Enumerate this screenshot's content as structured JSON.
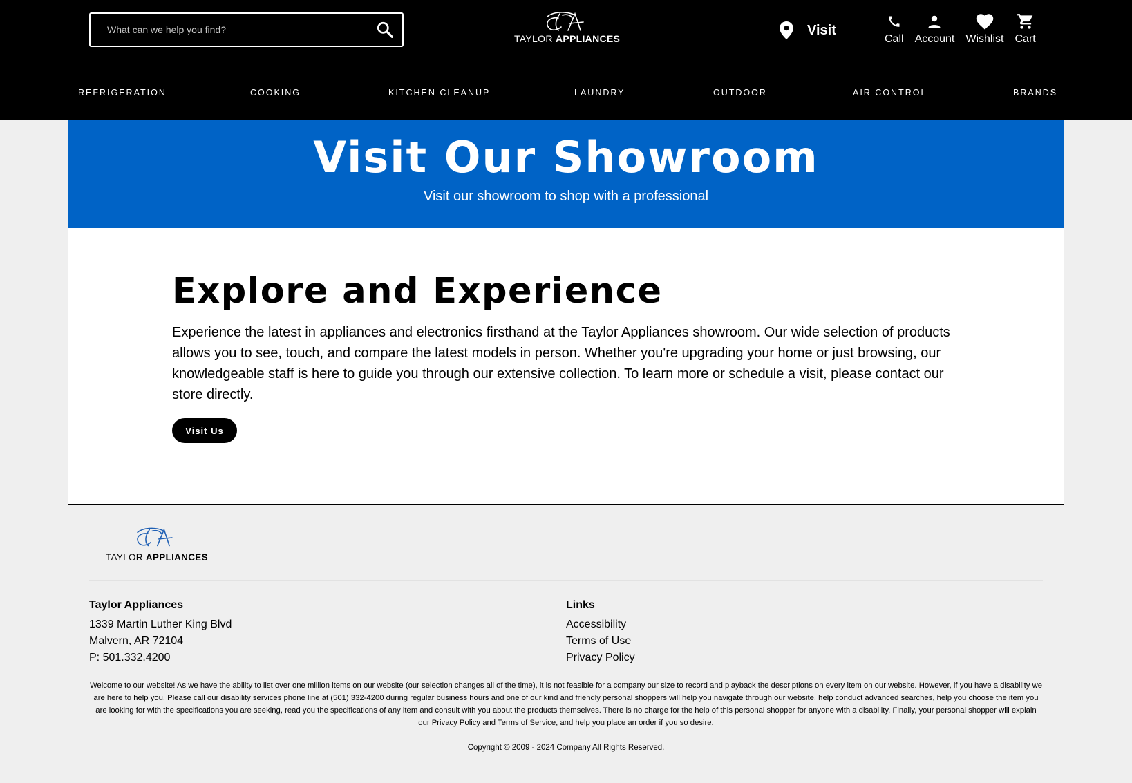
{
  "header": {
    "search": {
      "placeholder": "What can we help you find?",
      "icon": "search-icon"
    },
    "logo": {
      "text_light": "TAYLOR ",
      "text_bold": "APPLIANCES"
    },
    "visit": {
      "label": "Visit",
      "icon": "location-pin-icon"
    },
    "tools": [
      {
        "label": "Call",
        "icon": "phone-icon"
      },
      {
        "label": "Account",
        "icon": "user-icon"
      },
      {
        "label": "Wishlist",
        "icon": "heart-icon"
      },
      {
        "label": "Cart",
        "icon": "cart-icon"
      }
    ]
  },
  "nav": {
    "items": [
      "REFRIGERATION",
      "COOKING",
      "KITCHEN CLEANUP",
      "LAUNDRY",
      "OUTDOOR",
      "AIR CONTROL",
      "BRANDS"
    ]
  },
  "hero": {
    "title": "Visit Our Showroom",
    "subtitle": "Visit our showroom to shop with a professional"
  },
  "main": {
    "heading": "Explore and Experience",
    "body": "Experience the latest in appliances and electronics firsthand at the Taylor Appliances showroom. Our wide selection of products allows you to see, touch, and compare the latest models in person. Whether you're upgrading your home or just browsing, our knowledgeable staff is here to guide you through our extensive collection. To learn more or schedule a visit, please contact our store directly.",
    "button_label": "Visit Us"
  },
  "footer": {
    "logo": {
      "text_light": "TAYLOR ",
      "text_bold": "APPLIANCES"
    },
    "store": {
      "name": "Taylor Appliances",
      "address1": "1339 Martin Luther King Blvd",
      "address2": "Malvern, AR 72104",
      "phone": "P: 501.332.4200"
    },
    "links": {
      "heading": "Links",
      "items": [
        "Accessibility",
        "Terms of Use",
        "Privacy Policy"
      ]
    },
    "disclaimer": {
      "part1": "Welcome to our website! As we have the ability to list over one million items on our website (our selection changes all of the time), it is not feasible for a company our size to record and playback the descriptions on every item on our website. However, if you have a disability we are here to help you. Please call our disability services phone line at (501) 332-4200 during regular business hours and one of our kind and friendly personal shoppers will help you navigate through our website, help conduct advanced searches, help you choose the item you are looking for with the specifications you are seeking, read you the specifications of any item and consult with you about the products themselves. There is no charge for the help of this personal shopper for anyone with a disability. Finally, your personal shopper will explain our ",
      "privacy_link": "Privacy Policy",
      "part2": " and ",
      "terms_link": "Terms of Service",
      "part3": ", and help you place an order if you so desire."
    },
    "copyright": "Copyright © 2009 - 2024 Company All Rights Reserved."
  },
  "colors": {
    "header_bg": "#000000",
    "hero_bg": "#0063c6",
    "logo_blue": "#1e5fb4",
    "footer_bg": "#efefef"
  }
}
